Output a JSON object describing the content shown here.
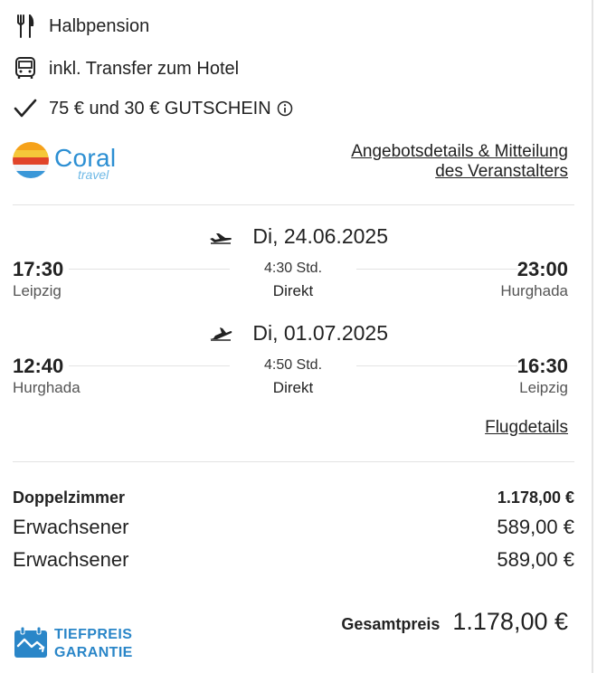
{
  "features": [
    {
      "icon": "fork-knife-icon",
      "label": "Halbpension"
    },
    {
      "icon": "bus-icon",
      "label": "inkl. Transfer zum Hotel"
    },
    {
      "icon": "checkmark-icon",
      "label": "75 € und 30 € GUTSCHEIN"
    }
  ],
  "operator": {
    "logo_text": "Coral",
    "logo_subtext": "travel",
    "details_link_line1": "Angebotsdetails & Mitteilung",
    "details_link_line2": "des Veranstalters"
  },
  "flights": [
    {
      "date": "Di, 24.06.2025",
      "direction_icon": "plane-departure-icon",
      "depart_time": "17:30",
      "depart_city": "Leipzig",
      "duration": "4:30 Std.",
      "type": "Direkt",
      "arrive_time": "23:00",
      "arrive_city": "Hurghada"
    },
    {
      "date": "Di, 01.07.2025",
      "direction_icon": "plane-return-icon",
      "depart_time": "12:40",
      "depart_city": "Hurghada",
      "duration": "4:50 Std.",
      "type": "Direkt",
      "arrive_time": "16:30",
      "arrive_city": "Leipzig"
    }
  ],
  "flight_details_link": "Flugdetails",
  "pricing": {
    "room": {
      "label": "Doppelzimmer",
      "price": "1.178,00 €"
    },
    "persons": [
      {
        "label": "Erwachsener",
        "price": "589,00 €"
      },
      {
        "label": "Erwachsener",
        "price": "589,00 €"
      }
    ],
    "total_label": "Gesamtpreis",
    "total_value": "1.178,00 €"
  },
  "badge": {
    "line1": "TIEFPREIS",
    "line2": "GARANTIE",
    "color": "#2a86c8"
  }
}
